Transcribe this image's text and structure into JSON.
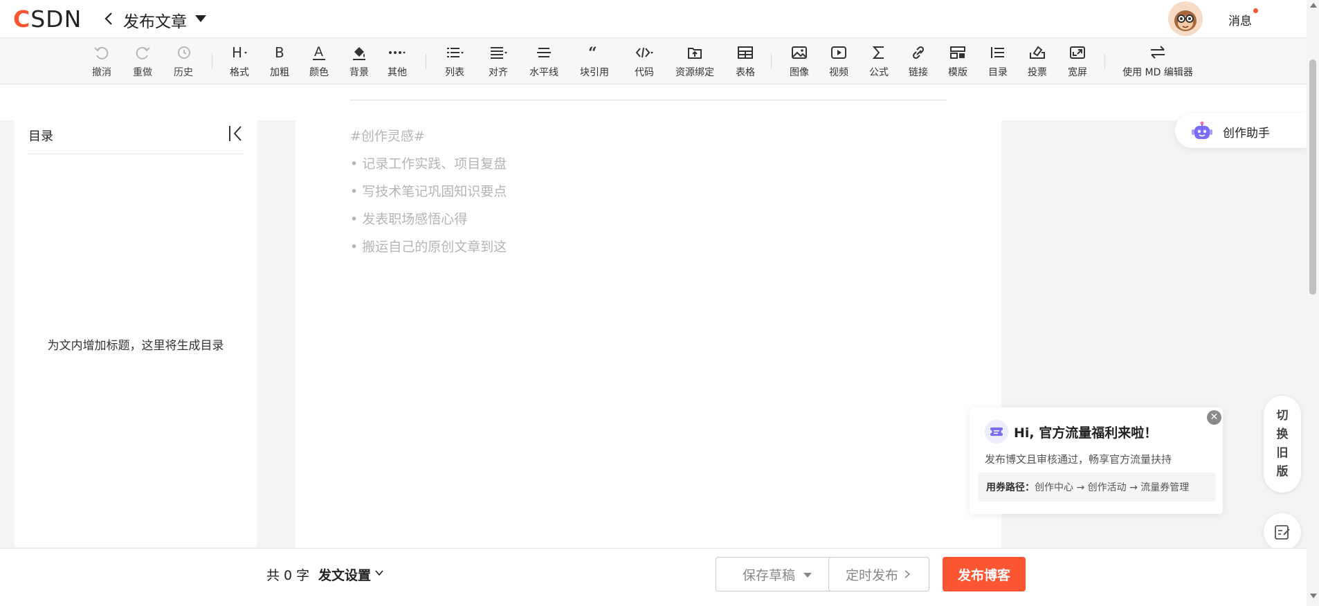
{
  "header": {
    "logo": "CSDN",
    "title": "发布文章",
    "messages_label": "消息"
  },
  "toolbar": {
    "tools": [
      {
        "label": "撤消",
        "icon": "undo-icon"
      },
      {
        "label": "重做",
        "icon": "redo-icon"
      },
      {
        "label": "历史",
        "icon": "history-icon"
      },
      {
        "label": "格式",
        "icon": "heading-icon"
      },
      {
        "label": "加粗",
        "icon": "bold-icon"
      },
      {
        "label": "颜色",
        "icon": "font-color-icon"
      },
      {
        "label": "背景",
        "icon": "background-fill-icon"
      },
      {
        "label": "其他",
        "icon": "more-icon"
      },
      {
        "label": "列表",
        "icon": "list-icon"
      },
      {
        "label": "对齐",
        "icon": "align-icon"
      },
      {
        "label": "水平线",
        "icon": "horizontal-rule-icon"
      },
      {
        "label": "块引用",
        "icon": "blockquote-icon"
      },
      {
        "label": "代码",
        "icon": "code-icon"
      },
      {
        "label": "资源绑定",
        "icon": "resource-bind-icon"
      },
      {
        "label": "表格",
        "icon": "table-icon"
      },
      {
        "label": "图像",
        "icon": "image-icon"
      },
      {
        "label": "视频",
        "icon": "video-icon"
      },
      {
        "label": "公式",
        "icon": "formula-icon"
      },
      {
        "label": "链接",
        "icon": "link-icon"
      },
      {
        "label": "模版",
        "icon": "template-icon"
      },
      {
        "label": "目录",
        "icon": "toc-icon"
      },
      {
        "label": "投票",
        "icon": "vote-icon"
      },
      {
        "label": "宽屏",
        "icon": "widescreen-icon"
      },
      {
        "label": "使用 MD 编辑器",
        "icon": "switch-editor-icon"
      }
    ]
  },
  "toc": {
    "title": "目录",
    "empty_text": "为文内增加标题，这里将生成目录"
  },
  "editor": {
    "hints": [
      "#创作灵感#",
      "• 记录工作实践、项目复盘",
      "• 写技术笔记巩固知识要点",
      "• 发表职场感悟心得",
      "• 搬运自己的原创文章到这"
    ]
  },
  "assistant": {
    "label": "创作助手"
  },
  "promo": {
    "title": "Hi, 官方流量福利来啦！",
    "desc": "发布博文且审核通过，畅享官方流量扶持",
    "path_label": "用券路径：",
    "path_value": "创作中心 → 创作活动 → 流量券管理"
  },
  "side": {
    "switch_old_chars": [
      "切",
      "换",
      "旧",
      "版"
    ]
  },
  "footer": {
    "word_count": "共 0 字",
    "publish_settings": "发文设置",
    "save_draft": "保存草稿",
    "scheduled_publish": "定时发布",
    "publish": "发布博客"
  },
  "colors": {
    "accent": "#fc5531"
  }
}
